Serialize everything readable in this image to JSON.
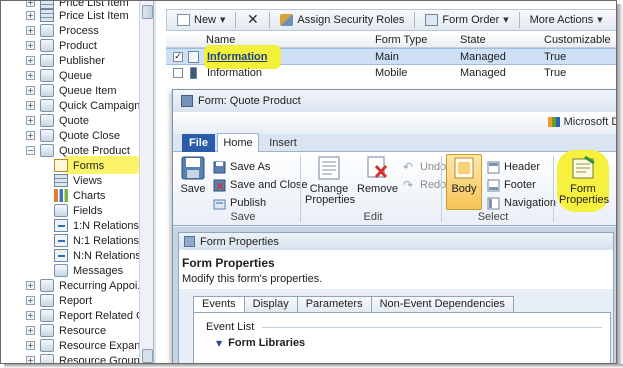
{
  "nav": {
    "items": [
      {
        "label": "Price List Item",
        "icon": "grid-icon"
      },
      {
        "label": "Process",
        "icon": "process-icon"
      },
      {
        "label": "Product",
        "icon": "product-icon"
      },
      {
        "label": "Publisher",
        "icon": "publisher-icon"
      },
      {
        "label": "Queue",
        "icon": "queue-icon"
      },
      {
        "label": "Queue Item",
        "icon": "queue-item-icon"
      },
      {
        "label": "Quick Campaign",
        "icon": "campaign-icon"
      },
      {
        "label": "Quote",
        "icon": "quote-icon"
      },
      {
        "label": "Quote Close",
        "icon": "quote-close-icon"
      },
      {
        "label": "Quote Product",
        "icon": "quote-product-icon"
      }
    ],
    "children": [
      {
        "label": "Forms",
        "icon": "forms-icon"
      },
      {
        "label": "Views",
        "icon": "views-icon"
      },
      {
        "label": "Charts",
        "icon": "charts-icon"
      },
      {
        "label": "Fields",
        "icon": "fields-icon"
      },
      {
        "label": "1:N Relations...",
        "icon": "relation-icon"
      },
      {
        "label": "N:1 Relations...",
        "icon": "relation-icon"
      },
      {
        "label": "N:N Relations...",
        "icon": "relation-icon"
      },
      {
        "label": "Messages",
        "icon": "messages-icon"
      }
    ],
    "after": [
      {
        "label": "Recurring Appoi...",
        "icon": "recurring-icon"
      },
      {
        "label": "Report",
        "icon": "report-icon"
      },
      {
        "label": "Report Related C...",
        "icon": "report-related-icon"
      },
      {
        "label": "Resource",
        "icon": "resource-icon"
      },
      {
        "label": "Resource Expans...",
        "icon": "resource-expansion-icon"
      },
      {
        "label": "Resource Group",
        "icon": "resource-group-icon"
      }
    ]
  },
  "toolbar": {
    "new_label": "New",
    "delete_icon": "delete-icon",
    "assign_label": "Assign Security Roles",
    "form_order_label": "Form Order",
    "more_actions_label": "More Actions"
  },
  "grid": {
    "columns": [
      "Name",
      "Form Type",
      "State",
      "Customizable"
    ],
    "rows": [
      {
        "name": "Information",
        "form_type": "Main",
        "state": "Managed",
        "customizable": "True",
        "checked": "✓"
      },
      {
        "name": "Information",
        "form_type": "Mobile",
        "state": "Managed",
        "customizable": "True",
        "checked": ""
      }
    ]
  },
  "form_window": {
    "title": "Form: Quote Product",
    "brand": "Microsoft Dyna",
    "tabs": {
      "file": "File",
      "home": "Home",
      "insert": "Insert"
    },
    "ribbon": {
      "save": "Save",
      "save_as": "Save As",
      "save_and_close": "Save and Close",
      "publish": "Publish",
      "group_save": "Save",
      "change_properties_1": "Change",
      "change_properties_2": "Properties",
      "remove": "Remove",
      "undo": "Undo",
      "redo": "Redo",
      "group_edit": "Edit",
      "body": "Body",
      "header": "Header",
      "footer": "Footer",
      "navigation": "Navigation",
      "group_select": "Select",
      "form_properties_1": "Form",
      "form_properties_2": "Properties"
    }
  },
  "form_properties": {
    "window_title": "Form Properties",
    "heading": "Form Properties",
    "subheading": "Modify this form's properties.",
    "tabs": [
      "Events",
      "Display",
      "Parameters",
      "Non-Event Dependencies"
    ],
    "event_list": "Event List",
    "form_libraries": "Form Libraries"
  },
  "colors": {
    "highlight": "#f3f03a",
    "file_tab": "#2a5caa",
    "selected_row": "#cde0f5"
  }
}
